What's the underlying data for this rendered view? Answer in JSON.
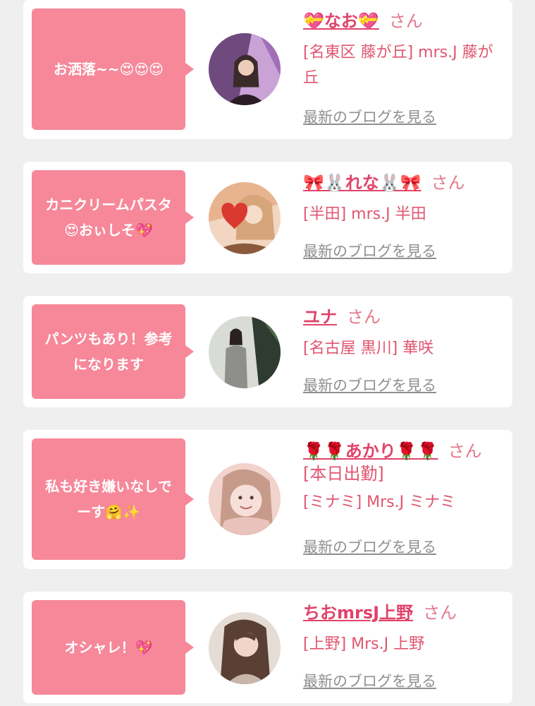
{
  "entries": [
    {
      "comment": "お洒落~~😍😍😍",
      "name": "💝なお💝",
      "suffix": "さん",
      "shop": "[名東区 藤が丘] mrs.J 藤が丘",
      "blog_link": "最新のブログを見る",
      "avatar_colors": [
        "#6e4a7e",
        "#c9a2d6",
        "#3b2a2a"
      ]
    },
    {
      "comment": "カニクリームパスタ😍おぃしそ💖",
      "name": "🎀🐰れな🐰🎀",
      "suffix": "さん",
      "shop": "[半田] mrs.J 半田",
      "blog_link": "最新のブログを見る",
      "avatar_colors": [
        "#e8b48f",
        "#d9392f",
        "#8b5a3c"
      ]
    },
    {
      "comment": "パンツもあり！参考になります",
      "name": "ユナ",
      "suffix": "さん",
      "shop": "[名古屋 黒川] 華咲",
      "blog_link": "最新のブログを見る",
      "avatar_colors": [
        "#d8dbd6",
        "#8e8e8a",
        "#2f3a30"
      ]
    },
    {
      "comment": "私も好き嫌いなしでーす🤗✨",
      "name": "🌹🌹あかり🌹🌹",
      "suffix": "さん",
      "status": "[本日出勤]",
      "shop": "[ミナミ] Mrs.J ミナミ",
      "blog_link": "最新のブログを見る",
      "avatar_colors": [
        "#f1d3cc",
        "#c79b8a",
        "#e9c2bb"
      ]
    },
    {
      "comment": "オシャレ！💖",
      "name": "ちおmrsJ上野",
      "suffix": "さん",
      "shop": "[上野] Mrs.J 上野",
      "blog_link": "最新のブログを見る",
      "avatar_colors": [
        "#e6dcd6",
        "#5a4034",
        "#c8b6ab"
      ]
    }
  ]
}
